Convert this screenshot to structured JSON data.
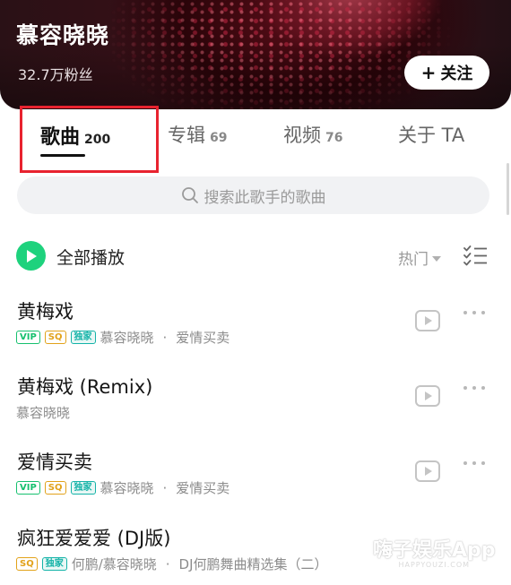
{
  "header": {
    "artist_name": "慕容晓晓",
    "fans": "32.7万粉丝",
    "follow_button": "关注",
    "follow_plus": "+"
  },
  "tabs": [
    {
      "label": "歌曲",
      "count": "200",
      "active": true
    },
    {
      "label": "专辑",
      "count": "69"
    },
    {
      "label": "视频",
      "count": "76"
    },
    {
      "label": "关于 TA",
      "count": ""
    }
  ],
  "search": {
    "placeholder": "搜索此歌手的歌曲"
  },
  "play_all": {
    "label": "全部播放"
  },
  "sort": {
    "label": "热门"
  },
  "songs": [
    {
      "title": "黄梅戏",
      "badges": [
        "VIP",
        "SQ",
        "独家"
      ],
      "artist": "慕容晓晓",
      "album": "爱情买卖"
    },
    {
      "title": "黄梅戏 (Remix)",
      "badges": [],
      "artist": "慕容晓晓",
      "album": ""
    },
    {
      "title": "爱情买卖",
      "badges": [
        "VIP",
        "SQ",
        "独家"
      ],
      "artist": "慕容晓晓",
      "album": "爱情买卖"
    },
    {
      "title": "疯狂爱爱爱 (DJ版)",
      "badges": [
        "SQ",
        "独家"
      ],
      "artist": "何鹏/慕容晓晓",
      "album": "DJ何鹏舞曲精选集（二）"
    }
  ],
  "watermark": {
    "main": "嗨子娱乐App",
    "sub": "HAPPYOUZI.COM"
  },
  "colors": {
    "accent_green": "#1ed27d",
    "highlight_red": "#e8232f",
    "vip_badge": "#16c06e",
    "sq_badge": "#e2a21a",
    "exclusive_badge": "#14b3a8"
  },
  "icons": {
    "search": "search-icon",
    "play_all": "play-circle-icon",
    "sort_caret": "caret-down-icon",
    "list_manage": "list-check-icon",
    "mv": "video-play-icon",
    "more": "more-dots-icon"
  }
}
